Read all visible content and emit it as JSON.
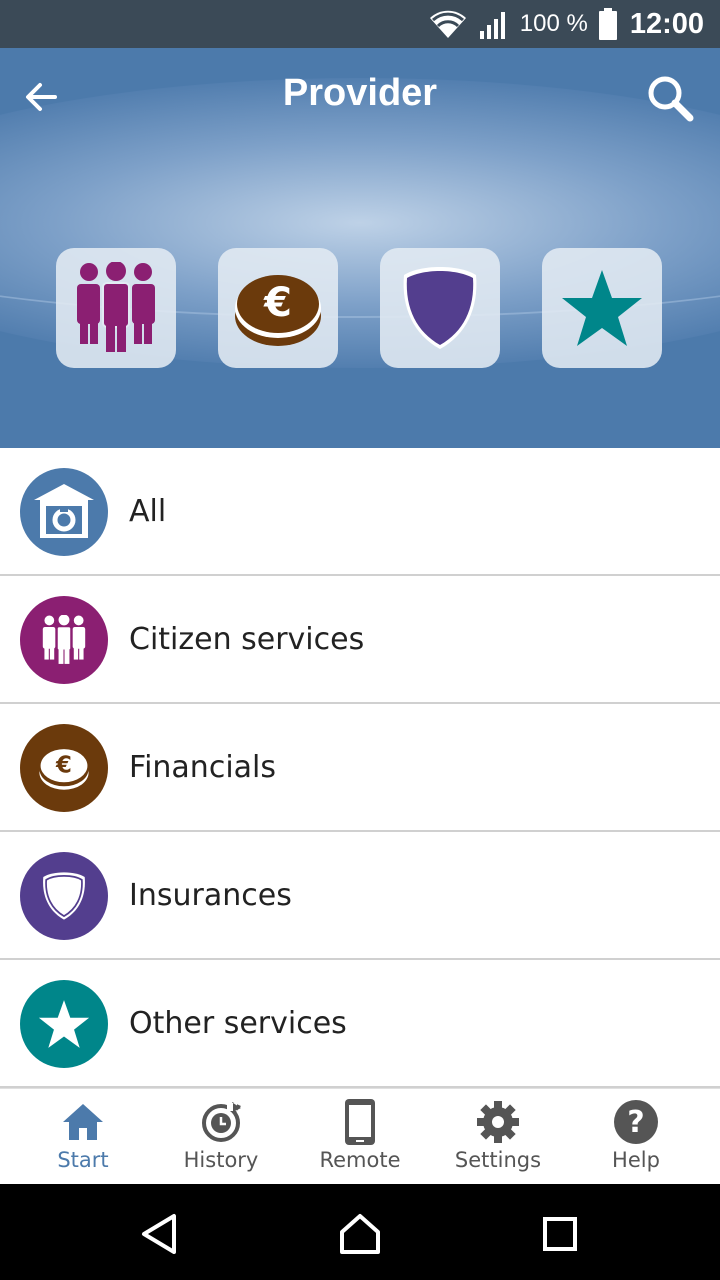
{
  "status_bar": {
    "battery": "100 %",
    "time": "12:00"
  },
  "header": {
    "title": "Provider",
    "tiles": [
      {
        "icon": "citizen-services-icon",
        "color": "#8b1f72"
      },
      {
        "icon": "euro-coin-icon",
        "color": "#6b3a0c"
      },
      {
        "icon": "shield-icon",
        "color": "#533e8e"
      },
      {
        "icon": "star-icon",
        "color": "#00868a"
      }
    ]
  },
  "list": {
    "items": [
      {
        "label": "All",
        "icon": "all-providers-icon",
        "color": "#4c7aab"
      },
      {
        "label": "Citizen services",
        "icon": "citizen-services-icon",
        "color": "#8b1f72"
      },
      {
        "label": "Financials",
        "icon": "euro-coin-icon",
        "color": "#6b3a0c"
      },
      {
        "label": "Insurances",
        "icon": "shield-icon",
        "color": "#533e8e"
      },
      {
        "label": "Other services",
        "icon": "star-icon",
        "color": "#00868a"
      }
    ]
  },
  "bottom_nav": {
    "items": [
      {
        "label": "Start",
        "icon": "home-icon",
        "active": true
      },
      {
        "label": "History",
        "icon": "history-icon",
        "active": false
      },
      {
        "label": "Remote",
        "icon": "phone-icon",
        "active": false
      },
      {
        "label": "Settings",
        "icon": "gear-icon",
        "active": false
      },
      {
        "label": "Help",
        "icon": "help-icon",
        "active": false
      }
    ]
  },
  "colors": {
    "accent": "#4c7aab",
    "status_bar": "#3b4a57"
  }
}
